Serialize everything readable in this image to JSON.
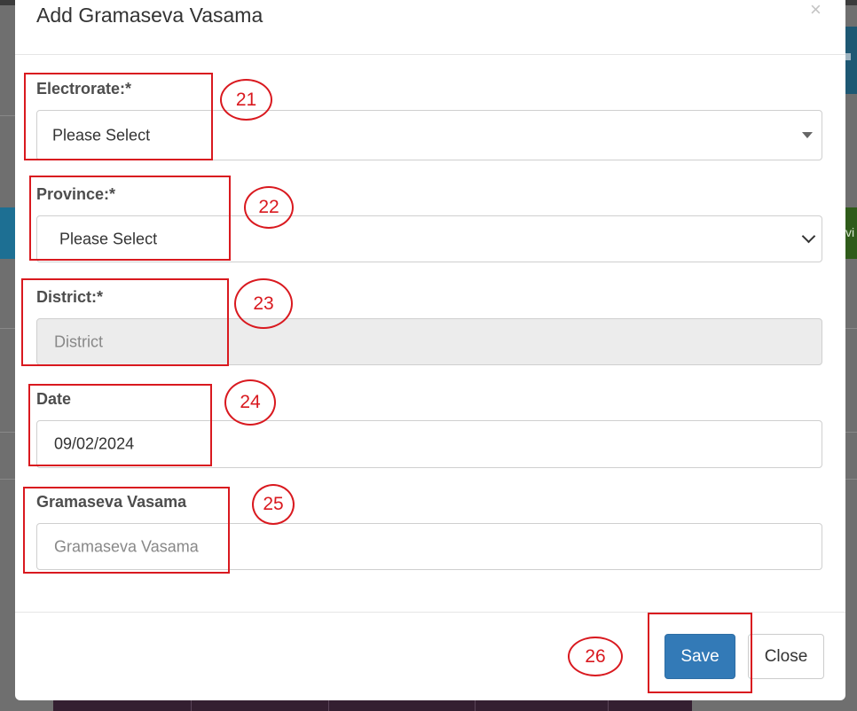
{
  "dialog": {
    "title": "Add Gramaseva Vasama",
    "close_glyph": "×"
  },
  "form": {
    "electorate": {
      "label": "Electrorate:*",
      "value": "Please Select"
    },
    "province": {
      "label": "Province:*",
      "value": "Please Select"
    },
    "district": {
      "label": "District:*",
      "placeholder": "District"
    },
    "date": {
      "label": "Date",
      "value": "09/02/2024"
    },
    "gramaseva_vasama": {
      "label": "Gramaseva Vasama",
      "placeholder": "Gramaseva Vasama"
    }
  },
  "footer": {
    "save_label": "Save",
    "close_label": "Close"
  },
  "annotations": [
    "21",
    "22",
    "23",
    "24",
    "25",
    "26"
  ],
  "background": {
    "partial_text": "vi"
  },
  "colors": {
    "primary": "#337ab7",
    "annotation_red": "#d9191f"
  }
}
